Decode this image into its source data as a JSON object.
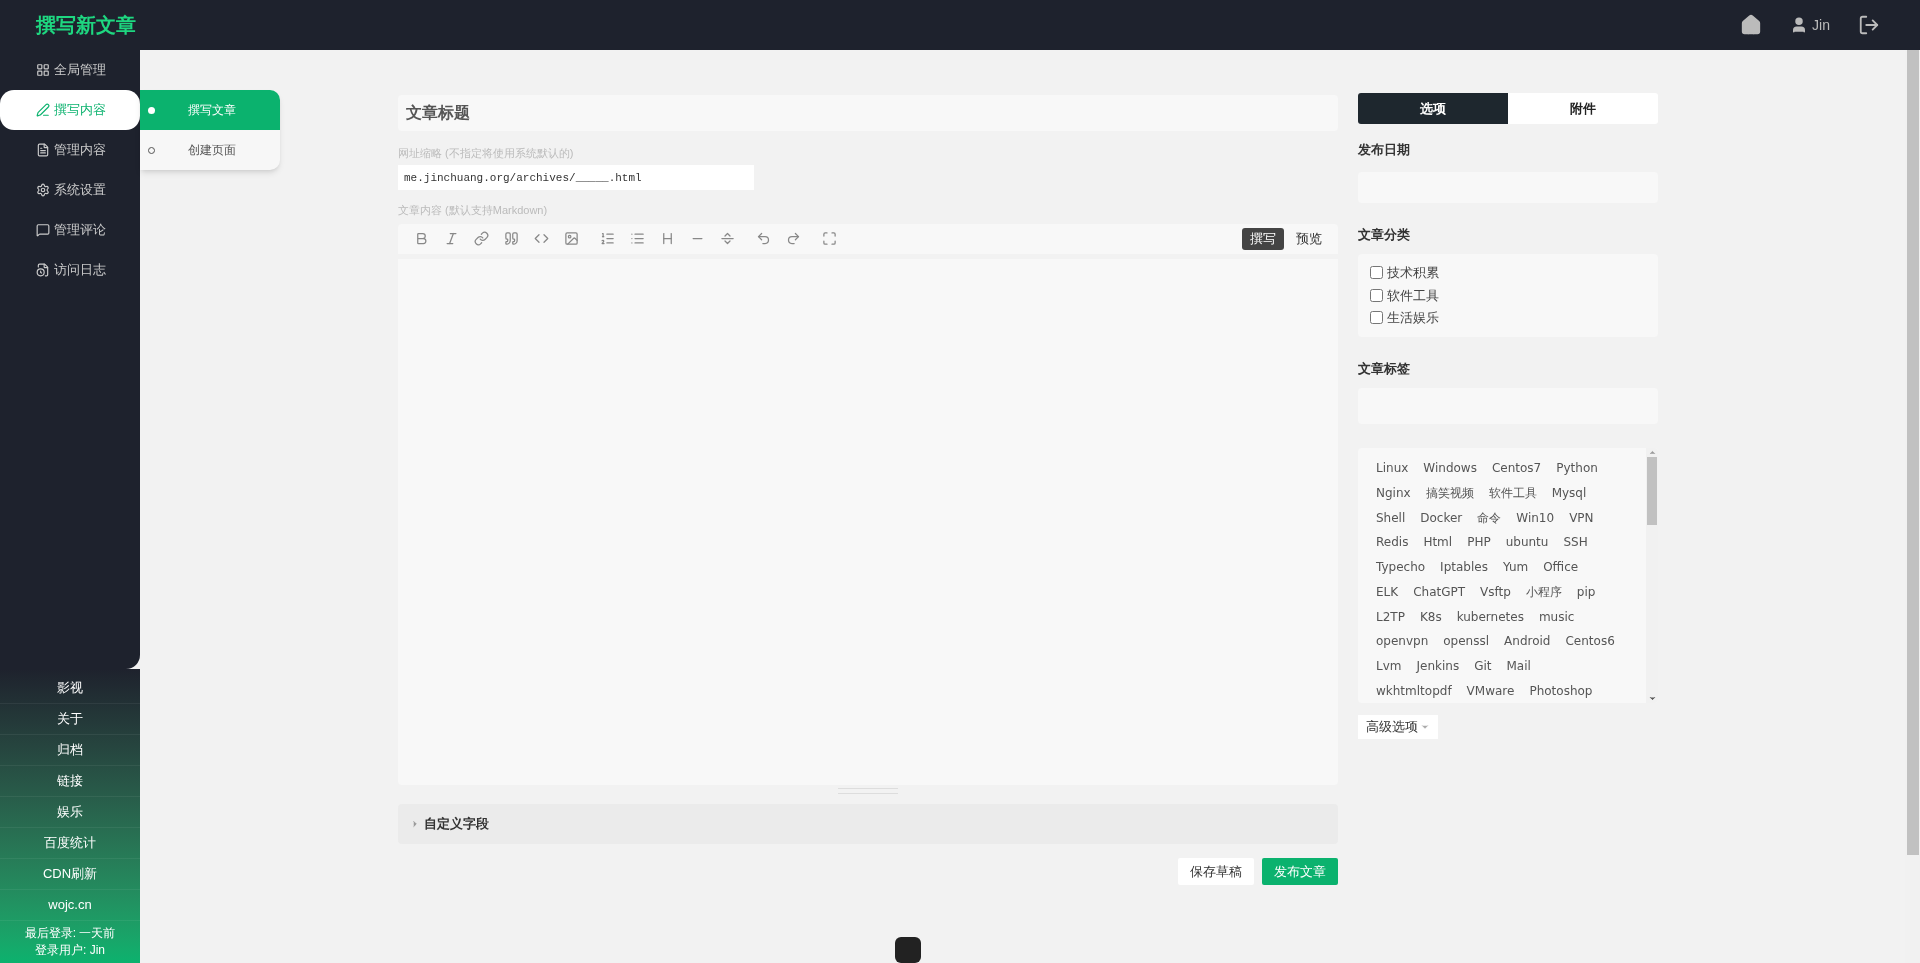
{
  "header": {
    "title": "撰写新文章",
    "user": "Jin"
  },
  "sidebar": {
    "items": [
      {
        "label": "全局管理",
        "selected": false
      },
      {
        "label": "撰写内容",
        "selected": true
      },
      {
        "label": "管理内容",
        "selected": false
      },
      {
        "label": "系统设置",
        "selected": false
      },
      {
        "label": "管理评论",
        "selected": false
      },
      {
        "label": "访问日志",
        "selected": false
      }
    ],
    "links": [
      "影视",
      "关于",
      "归档",
      "链接",
      "娱乐",
      "百度统计",
      "CDN刷新",
      "wojc.cn"
    ],
    "footer": [
      "最后登录: 一天前",
      "登录用户: Jin"
    ]
  },
  "submenu": [
    {
      "label": "撰写文章",
      "selected": true
    },
    {
      "label": "创建页面",
      "selected": false
    }
  ],
  "editor": {
    "title_placeholder": "文章标题",
    "slug_label": "网址缩略 (不指定将使用系统默认的)",
    "slug_value": "me.jinchuang.org/archives/_____.html",
    "content_label": "文章内容 (默认支持Markdown)",
    "modes": [
      {
        "label": "撰写",
        "selected": true
      },
      {
        "label": "预览",
        "selected": false
      }
    ],
    "custom_fields": "自定义字段",
    "buttons": [
      {
        "label": "保存草稿",
        "kind": "secondary"
      },
      {
        "label": "发布文章",
        "kind": "primary"
      }
    ]
  },
  "panel": {
    "tabs": [
      {
        "label": "选项",
        "selected": true
      },
      {
        "label": "附件",
        "selected": false
      }
    ],
    "date_label": "发布日期",
    "category_label": "文章分类",
    "categories": [
      {
        "label": "技术积累",
        "checked": false
      },
      {
        "label": "软件工具",
        "checked": false
      },
      {
        "label": "生活娱乐",
        "checked": false
      }
    ],
    "tags_label": "文章标签",
    "tags": [
      [
        "Linux",
        "Windows",
        "Centos7",
        "Python"
      ],
      [
        "Nginx",
        "搞笑视频",
        "软件工具",
        "Mysql"
      ],
      [
        "Shell",
        "Docker",
        "命令",
        "Win10",
        "VPN"
      ],
      [
        "Redis",
        "Html",
        "PHP",
        "ubuntu",
        "SSH"
      ],
      [
        "Typecho",
        "Iptables",
        "Yum",
        "Office"
      ],
      [
        "ELK",
        "ChatGPT",
        "Vsftp",
        "小程序",
        "pip"
      ],
      [
        "L2TP",
        "K8s",
        "kubernetes",
        "music"
      ],
      [
        "openvpn",
        "openssl",
        "Android",
        "Centos6"
      ],
      [
        "Lvm",
        "Jenkins",
        "Git",
        "Mail"
      ],
      [
        "wkhtmltopdf",
        "VMware",
        "Photoshop"
      ]
    ],
    "advanced": "高级选项"
  }
}
